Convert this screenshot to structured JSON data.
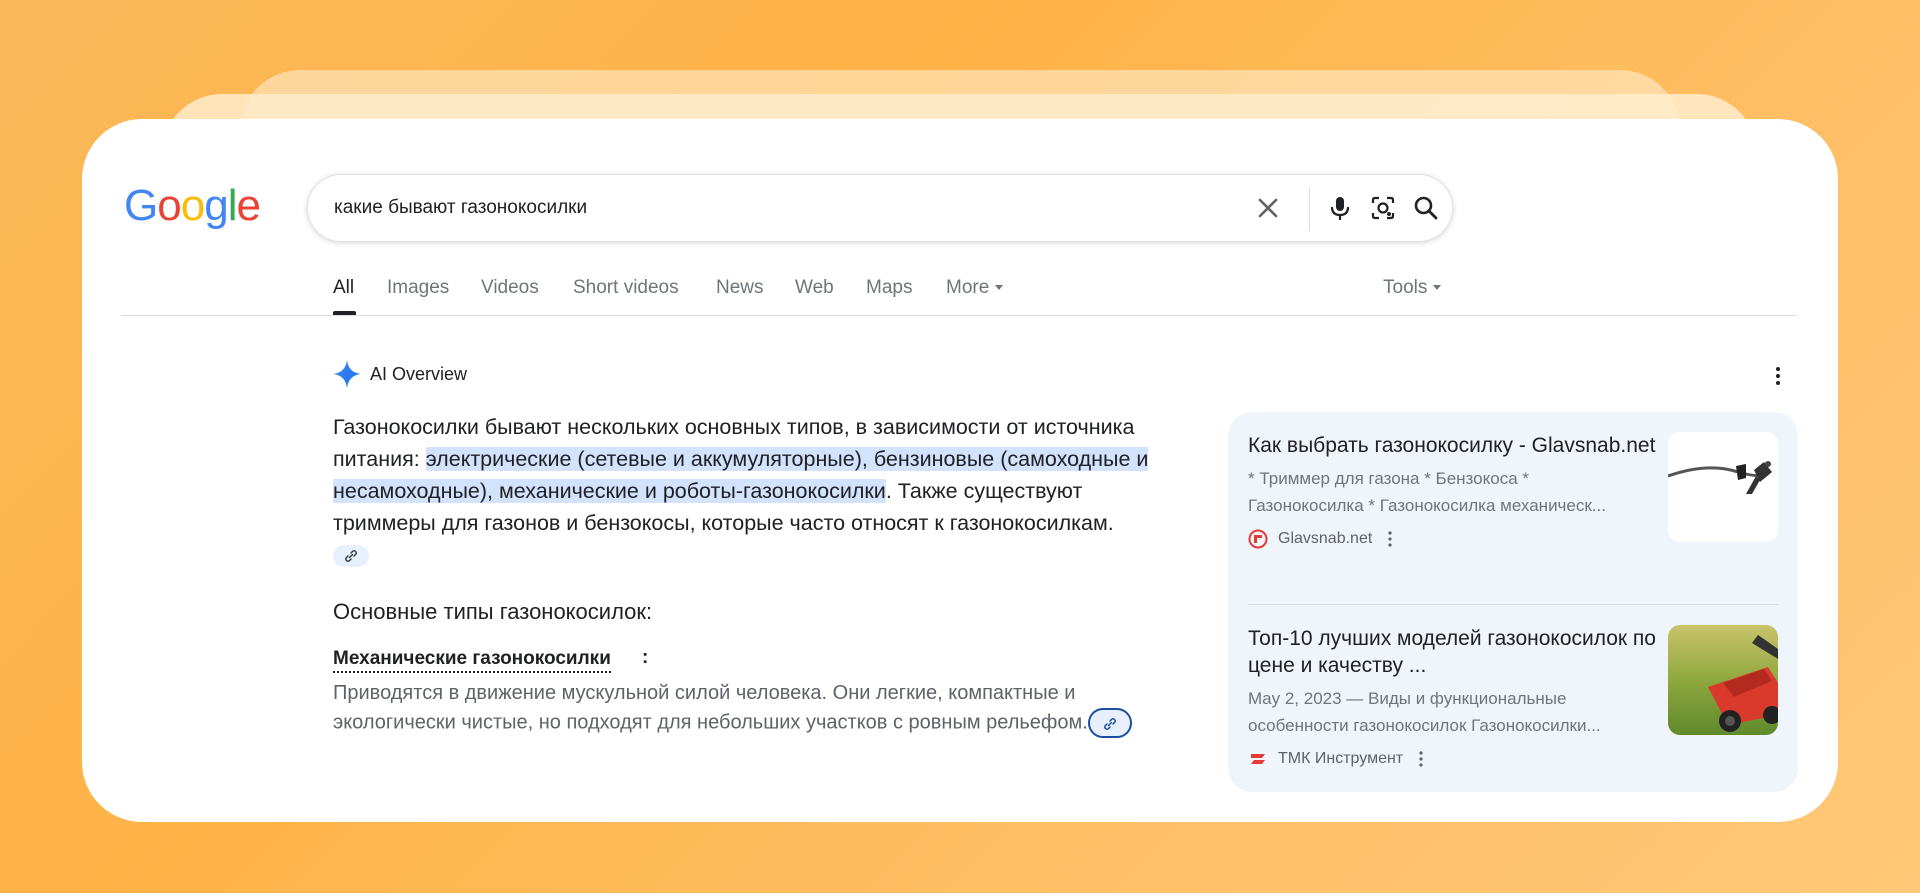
{
  "search": {
    "query": "какие бывают газонокосилки"
  },
  "logo": {
    "letters": [
      "G",
      "o",
      "o",
      "g",
      "l",
      "e"
    ],
    "colors": [
      "#4285f4",
      "#ea4335",
      "#fbbc05",
      "#4285f4",
      "#34a853",
      "#ea4335"
    ]
  },
  "tabs": [
    {
      "label": "All"
    },
    {
      "label": "Images"
    },
    {
      "label": "Videos"
    },
    {
      "label": "Short videos"
    },
    {
      "label": "News"
    },
    {
      "label": "Web"
    },
    {
      "label": "Maps"
    },
    {
      "label": "More"
    }
  ],
  "tools_label": "Tools",
  "ai_overview": {
    "title": "AI Overview",
    "intro_plain_1": "Газонокосилки бывают нескольких основных типов, в зависимости от источника питания: ",
    "intro_highlight": "электрические (сетевые и аккумуляторные), бензиновые (самоходные и несамоходные), механические и роботы-газонокосилки",
    "intro_plain_2": ". Также существуют триммеры для газонов и бензокосы, которые часто относят к газонокосилкам.",
    "section_title": "Основные типы газонокосилок:",
    "subsection_title": "Механические газонокосилки",
    "subsection_colon": ":",
    "subsection_text": "Приводятся в движение мускульной силой человека. Они легкие, компактные и экологически чистые, но подходят для небольших участков с ровным рельефом."
  },
  "sources": [
    {
      "title": "Как выбрать газонокосилку - Glavsnab.net",
      "snippet_line1": "* Триммер для газона * Бензокоса *",
      "snippet_line2": "Газонокосилка * Газонокосилка механическ...",
      "site": "Glavsnab.net"
    },
    {
      "title": "Топ-10 лучших моделей газонокосилок по цене и качеству ...",
      "snippet_line1": "May 2, 2023 — Виды и функциональные",
      "snippet_line2": "особенности газонокосилок Газонокосилки...",
      "site": "ТМК Инструмент"
    }
  ],
  "colors": {
    "accent_blue": "#1a73e8",
    "highlight": "#d3e3fd",
    "background_orange": "#ffb347"
  }
}
